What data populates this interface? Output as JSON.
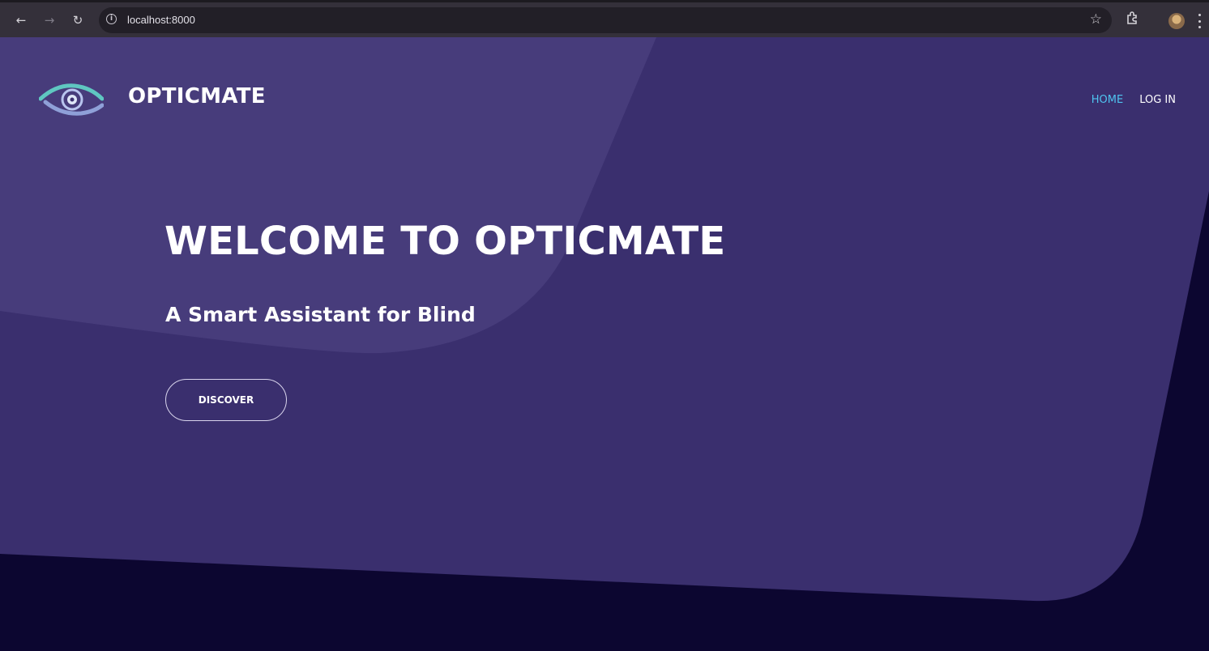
{
  "browser": {
    "url": "localhost:8000"
  },
  "header": {
    "brand": "OPTICMATE",
    "nav": [
      {
        "label": "HOME",
        "active": true
      },
      {
        "label": "LOG IN",
        "active": false
      }
    ]
  },
  "hero": {
    "title": "WELCOME TO OPTICMATE",
    "subtitle": "A Smart Assistant for Blind",
    "cta_label": "DISCOVER"
  },
  "colors": {
    "hero_background": "#3a2f6e",
    "hero_highlight": "#473c7b",
    "page_background": "#0c0630",
    "nav_active": "#4fc3ef"
  }
}
